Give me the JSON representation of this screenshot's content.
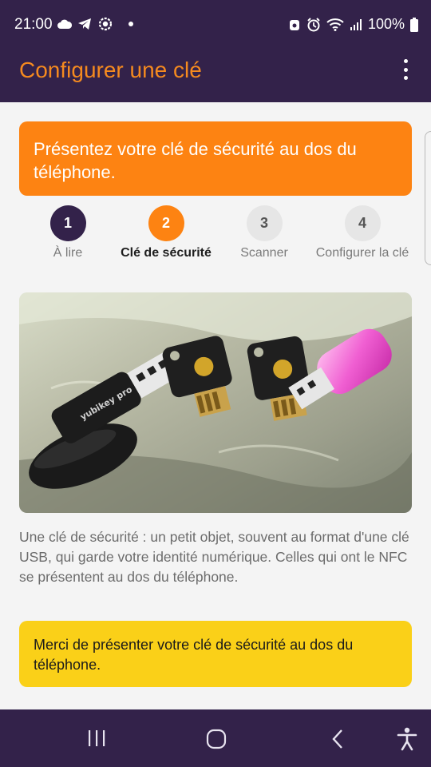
{
  "status_bar": {
    "time": "21:00",
    "battery": "100%",
    "icons_left": [
      "cloud-icon",
      "telegram-icon",
      "settings-badge-icon",
      "dot-icon"
    ],
    "icons_right": [
      "alarm-icon",
      "wifi-icon",
      "signal-icon",
      "battery-icon"
    ]
  },
  "app_bar": {
    "title": "Configurer une clé",
    "menu_icon": "more-vert-icon",
    "title_color": "#f58a1f",
    "background": "#33224a"
  },
  "instruction_banner": {
    "text": "Présentez votre clé de sécurité au dos du téléphone.",
    "color": "#fd8312"
  },
  "stepper": {
    "steps": [
      {
        "number": "1",
        "label": "À lire",
        "state": "done"
      },
      {
        "number": "2",
        "label": "Clé de sécurité",
        "state": "active"
      },
      {
        "number": "3",
        "label": "Scanner",
        "state": "todo"
      },
      {
        "number": "4",
        "label": "Configurer la clé",
        "state": "todo"
      }
    ]
  },
  "photo": {
    "subject": "security-keys-photo",
    "key_brand_text": "yubikey pro"
  },
  "description": "Une clé de sécurité : un petit objet, souvent au format d'une clé USB, qui garde votre identité numérique. Celles qui ont le NFC se présentent au dos du téléphone.",
  "alert_banner": {
    "text": "Merci de présenter votre clé de sécurité au dos du téléphone.",
    "color": "#fad018"
  },
  "nav_bar": {
    "buttons": [
      "recent-apps-icon",
      "home-icon",
      "back-icon",
      "accessibility-icon"
    ]
  }
}
